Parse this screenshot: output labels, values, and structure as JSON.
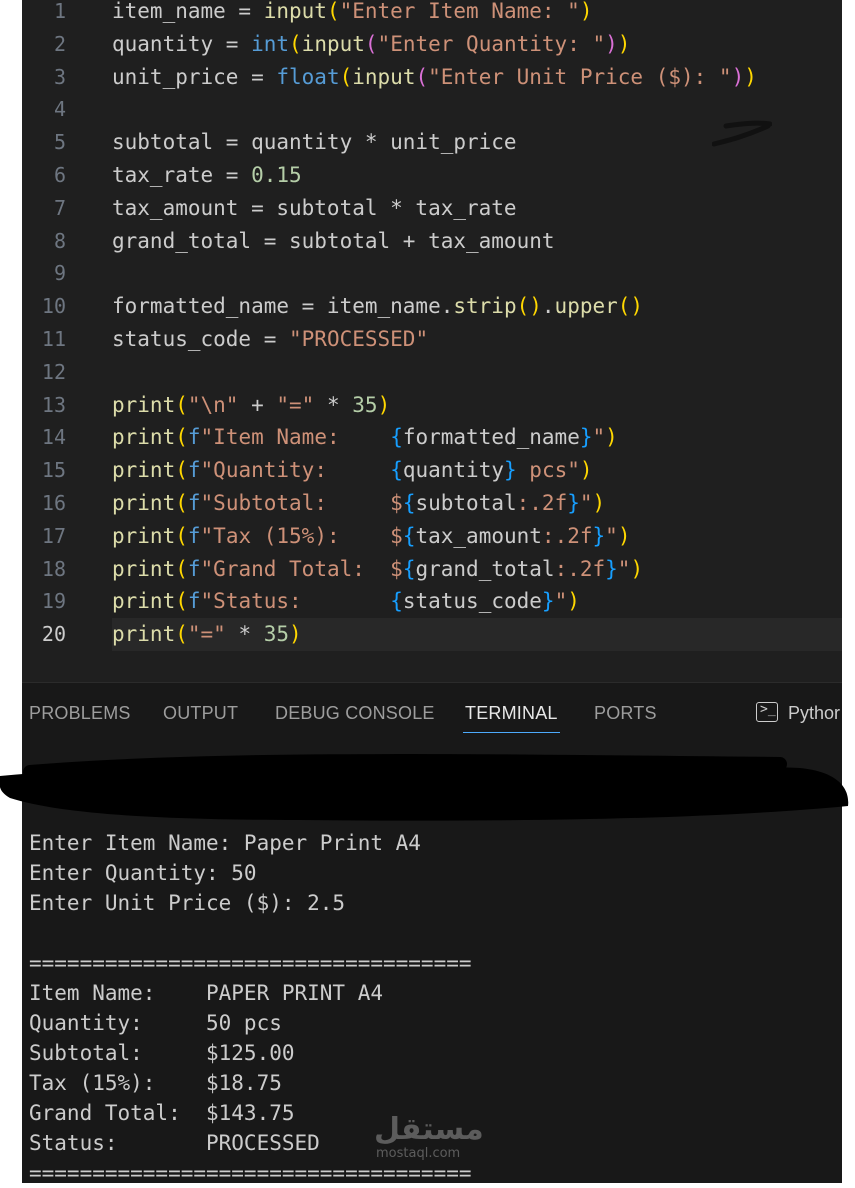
{
  "editor": {
    "current_line": 20,
    "lines": [
      {
        "num": "1",
        "tokens": [
          [
            "v",
            "item_name = "
          ],
          [
            "f",
            "input"
          ],
          [
            "b1",
            "("
          ],
          [
            "s",
            "\"Enter Item Name: \""
          ],
          [
            "b1",
            ")"
          ]
        ]
      },
      {
        "num": "2",
        "tokens": [
          [
            "v",
            "quantity = "
          ],
          [
            "k",
            "int"
          ],
          [
            "b1",
            "("
          ],
          [
            "f",
            "input"
          ],
          [
            "b2",
            "("
          ],
          [
            "s",
            "\"Enter Quantity: \""
          ],
          [
            "b2",
            ")"
          ],
          [
            "b1",
            ")"
          ]
        ]
      },
      {
        "num": "3",
        "tokens": [
          [
            "v",
            "unit_price = "
          ],
          [
            "k",
            "float"
          ],
          [
            "b1",
            "("
          ],
          [
            "f",
            "input"
          ],
          [
            "b2",
            "("
          ],
          [
            "s",
            "\"Enter Unit Price ($): \""
          ],
          [
            "b2",
            ")"
          ],
          [
            "b1",
            ")"
          ]
        ]
      },
      {
        "num": "4",
        "tokens": []
      },
      {
        "num": "5",
        "tokens": [
          [
            "v",
            "subtotal = quantity * unit_price"
          ]
        ]
      },
      {
        "num": "6",
        "tokens": [
          [
            "v",
            "tax_rate = "
          ],
          [
            "n",
            "0.15"
          ]
        ]
      },
      {
        "num": "7",
        "tokens": [
          [
            "v",
            "tax_amount = subtotal * tax_rate"
          ]
        ]
      },
      {
        "num": "8",
        "tokens": [
          [
            "v",
            "grand_total = subtotal + tax_amount"
          ]
        ]
      },
      {
        "num": "9",
        "tokens": []
      },
      {
        "num": "10",
        "tokens": [
          [
            "v",
            "formatted_name = item_name."
          ],
          [
            "f",
            "strip"
          ],
          [
            "b1",
            "()"
          ],
          [
            "v",
            "."
          ],
          [
            "f",
            "upper"
          ],
          [
            "b1",
            "()"
          ]
        ]
      },
      {
        "num": "11",
        "tokens": [
          [
            "v",
            "status_code = "
          ],
          [
            "s",
            "\"PROCESSED\""
          ]
        ]
      },
      {
        "num": "12",
        "tokens": []
      },
      {
        "num": "13",
        "tokens": [
          [
            "f",
            "print"
          ],
          [
            "b1",
            "("
          ],
          [
            "s",
            "\"\\n\""
          ],
          [
            "v",
            " + "
          ],
          [
            "s",
            "\"=\""
          ],
          [
            "v",
            " * "
          ],
          [
            "n",
            "35"
          ],
          [
            "b1",
            ")"
          ]
        ]
      },
      {
        "num": "14",
        "tokens": [
          [
            "f",
            "print"
          ],
          [
            "b1",
            "("
          ],
          [
            "k",
            "f"
          ],
          [
            "s",
            "\"Item Name:    "
          ],
          [
            "b3",
            "{"
          ],
          [
            "v",
            "formatted_name"
          ],
          [
            "b3",
            "}"
          ],
          [
            "s",
            "\""
          ],
          [
            "b1",
            ")"
          ]
        ]
      },
      {
        "num": "15",
        "tokens": [
          [
            "f",
            "print"
          ],
          [
            "b1",
            "("
          ],
          [
            "k",
            "f"
          ],
          [
            "s",
            "\"Quantity:     "
          ],
          [
            "b3",
            "{"
          ],
          [
            "v",
            "quantity"
          ],
          [
            "b3",
            "}"
          ],
          [
            "s",
            " pcs\""
          ],
          [
            "b1",
            ")"
          ]
        ]
      },
      {
        "num": "16",
        "tokens": [
          [
            "f",
            "print"
          ],
          [
            "b1",
            "("
          ],
          [
            "k",
            "f"
          ],
          [
            "s",
            "\"Subtotal:     $"
          ],
          [
            "b3",
            "{"
          ],
          [
            "v",
            "subtotal"
          ],
          [
            "s",
            ":.2f"
          ],
          [
            "b3",
            "}"
          ],
          [
            "s",
            "\""
          ],
          [
            "b1",
            ")"
          ]
        ]
      },
      {
        "num": "17",
        "tokens": [
          [
            "f",
            "print"
          ],
          [
            "b1",
            "("
          ],
          [
            "k",
            "f"
          ],
          [
            "s",
            "\"Tax (15%):    $"
          ],
          [
            "b3",
            "{"
          ],
          [
            "v",
            "tax_amount"
          ],
          [
            "s",
            ":.2f"
          ],
          [
            "b3",
            "}"
          ],
          [
            "s",
            "\""
          ],
          [
            "b1",
            ")"
          ]
        ]
      },
      {
        "num": "18",
        "tokens": [
          [
            "f",
            "print"
          ],
          [
            "b1",
            "("
          ],
          [
            "k",
            "f"
          ],
          [
            "s",
            "\"Grand Total:  $"
          ],
          [
            "b3",
            "{"
          ],
          [
            "v",
            "grand_total"
          ],
          [
            "s",
            ":.2f"
          ],
          [
            "b3",
            "}"
          ],
          [
            "s",
            "\""
          ],
          [
            "b1",
            ")"
          ]
        ]
      },
      {
        "num": "19",
        "tokens": [
          [
            "f",
            "print"
          ],
          [
            "b1",
            "("
          ],
          [
            "k",
            "f"
          ],
          [
            "s",
            "\"Status:       "
          ],
          [
            "b3",
            "{"
          ],
          [
            "v",
            "status_code"
          ],
          [
            "b3",
            "}"
          ],
          [
            "s",
            "\""
          ],
          [
            "b1",
            ")"
          ]
        ]
      },
      {
        "num": "20",
        "tokens": [
          [
            "f",
            "print"
          ],
          [
            "b1",
            "("
          ],
          [
            "s",
            "\"=\""
          ],
          [
            "v",
            " * "
          ],
          [
            "n",
            "35"
          ],
          [
            "b1",
            ")"
          ]
        ]
      }
    ]
  },
  "panel": {
    "tabs": [
      {
        "label": "PROBLEMS",
        "active": false
      },
      {
        "label": "OUTPUT",
        "active": false
      },
      {
        "label": "DEBUG CONSOLE",
        "active": false
      },
      {
        "label": "TERMINAL",
        "active": true
      },
      {
        "label": "PORTS",
        "active": false
      }
    ],
    "terminal_profile": "Pythor",
    "terminal_icon": "terminal-icon"
  },
  "terminal": {
    "lines": [
      "Enter Item Name: Paper Print A4",
      "Enter Quantity: 50",
      "Enter Unit Price ($): 2.5",
      "",
      "===================================",
      "Item Name:    PAPER PRINT A4",
      "Quantity:     50 pcs",
      "Subtotal:     $125.00",
      "Tax (15%):    $18.75",
      "Grand Total:  $143.75",
      "Status:       PROCESSED",
      "==================================="
    ]
  },
  "watermark": {
    "arabic": "مستقل",
    "latin": "mostaql.com"
  },
  "colors": {
    "editor_bg": "#1f1f1f",
    "panel_bg": "#181818",
    "function": "#dcdcaa",
    "string": "#ce9178",
    "number": "#b5cea8",
    "bracket_1": "#ffd700",
    "bracket_2": "#da70d6",
    "bracket_3": "#179fff",
    "keyword": "#569cd6",
    "active_tab_underline": "#4daafc"
  }
}
